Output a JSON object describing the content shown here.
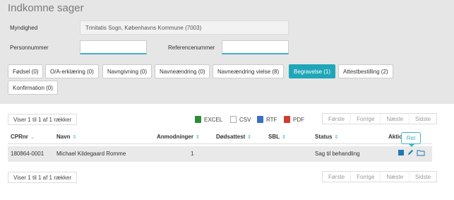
{
  "page_title": "Indkomne sager",
  "form": {
    "myndighed_label": "Myndighed",
    "myndighed_value": "Trinitatis Sogn, Københavns Kommune (7003)",
    "personnummer_label": "Personnummer",
    "personnummer_value": "",
    "referencenummer_label": "Referencenummer",
    "referencenummer_value": ""
  },
  "tabs": [
    {
      "label": "Fødsel (0)"
    },
    {
      "label": "O/A-erklæring (0)"
    },
    {
      "label": "Navngivning (0)"
    },
    {
      "label": "Navneændring (0)"
    },
    {
      "label": "Navneændring vielse (8)"
    },
    {
      "label": "Begravelse (1)",
      "active": true
    },
    {
      "label": "Attestbestilling (2)"
    },
    {
      "label": "Konfirmation (0)"
    }
  ],
  "table_info": "Viser 1 til 1 af 1 rækker",
  "export": {
    "excel": "EXCEL",
    "csv": "CSV",
    "rtf": "RTF",
    "pdf": "PDF"
  },
  "pager": {
    "first": "Første",
    "prev": "Forrige",
    "next": "Næste",
    "last": "Sidste"
  },
  "columns": {
    "cprnr": "CPRnr",
    "navn": "Navn",
    "anmodninger": "Anmodninger",
    "doedsattest": "Dødsattest",
    "sbl": "SBL",
    "status": "Status",
    "aktion": "Aktio"
  },
  "rows": [
    {
      "cprnr": "180864-0001",
      "navn": "Michael Kildegaard Romme",
      "anmodninger": "1",
      "doedsattest": "",
      "sbl": "",
      "status": "Sag til behandling"
    }
  ],
  "tooltip": "Ret",
  "colors": {
    "accent": "#1fa6b8",
    "panel": "#e6e6e6"
  }
}
